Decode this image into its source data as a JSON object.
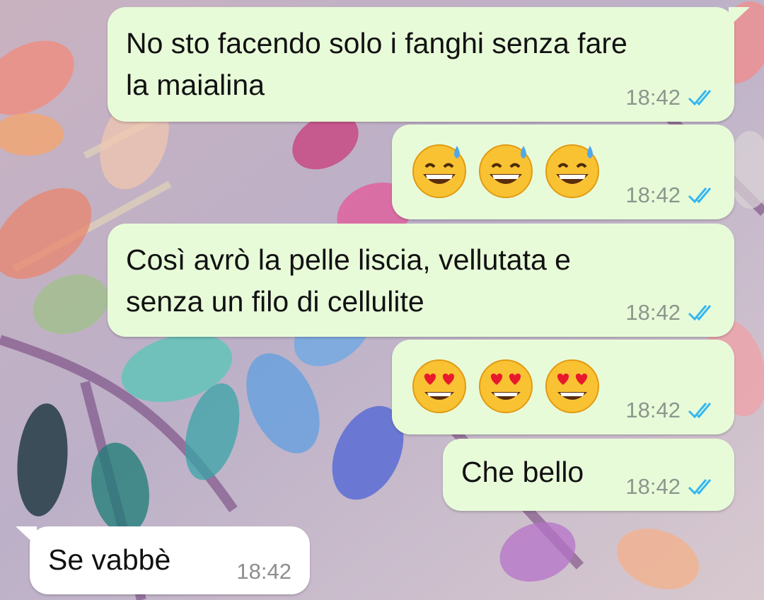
{
  "colors": {
    "outgoing_bubble": "#e8fbd9",
    "incoming_bubble": "#ffffff",
    "read_ticks": "#34b7f1",
    "timestamp": "#8c968c"
  },
  "messages": [
    {
      "direction": "outgoing",
      "text": "No sto facendo solo i fanghi senza fare\nla maialina",
      "time": "18:42",
      "status": "read"
    },
    {
      "direction": "outgoing",
      "emoji": [
        "grinning-face-with-sweat-icon",
        "grinning-face-with-sweat-icon",
        "grinning-face-with-sweat-icon"
      ],
      "time": "18:42",
      "status": "read"
    },
    {
      "direction": "outgoing",
      "text": "Così avrò la pelle liscia, vellutata e\nsenza un filo di cellulite",
      "time": "18:42",
      "status": "read"
    },
    {
      "direction": "outgoing",
      "emoji": [
        "heart-eyes-face-icon",
        "heart-eyes-face-icon",
        "heart-eyes-face-icon"
      ],
      "time": "18:42",
      "status": "read"
    },
    {
      "direction": "outgoing",
      "text": "Che bello",
      "time": "18:42",
      "status": "read"
    },
    {
      "direction": "incoming",
      "text": "Se vabbè",
      "time": "18:42"
    }
  ]
}
